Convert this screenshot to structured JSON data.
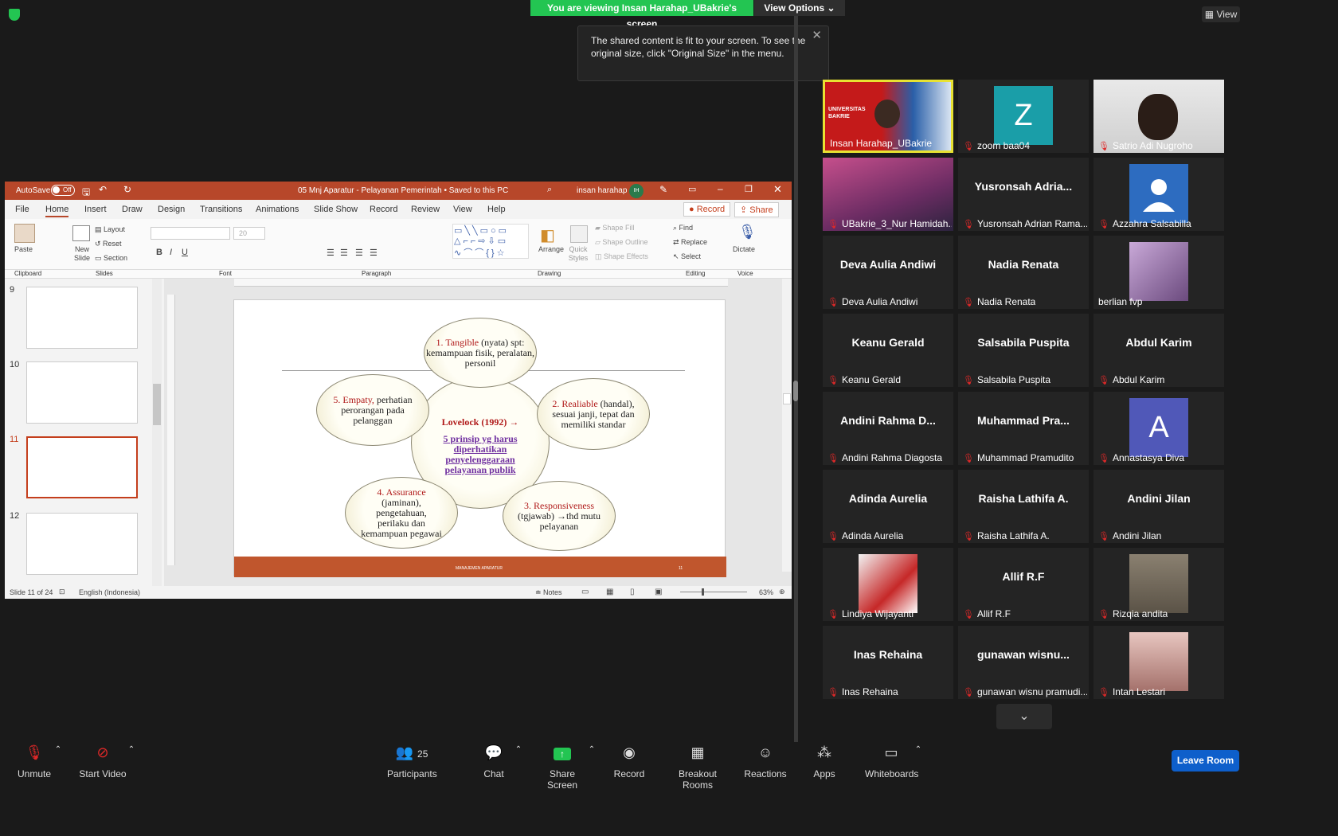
{
  "top": {
    "viewing_banner": "You are viewing Insan Harahap_UBakrie's screen",
    "view_options": "View Options",
    "view_button": "View",
    "tooltip": "The shared content is fit to your screen. To see the original size, click \"Original Size\" in the menu."
  },
  "ppt": {
    "autosave": "AutoSave",
    "autosave_state": "Off",
    "doc_title": "05 Mnj Aparatur - Pelayanan Pemerintah • Saved to this PC",
    "user": "insan harahap",
    "user_initials": "IH",
    "tabs": [
      "File",
      "Home",
      "Insert",
      "Draw",
      "Design",
      "Transitions",
      "Animations",
      "Slide Show",
      "Record",
      "Review",
      "View",
      "Help"
    ],
    "record_btn": "Record",
    "share_btn": "Share",
    "ribbon": {
      "paste": "Paste",
      "new_slide": "New Slide",
      "layout": "Layout",
      "reset": "Reset",
      "section": "Section",
      "font_size": "20",
      "arrange": "Arrange",
      "quick_styles": "Quick Styles",
      "shape_fill": "Shape Fill",
      "shape_outline": "Shape Outline",
      "shape_effects": "Shape Effects",
      "find": "Find",
      "replace": "Replace",
      "select": "Select",
      "dictate": "Dictate",
      "groups": [
        "Clipboard",
        "Slides",
        "Font",
        "Paragraph",
        "Drawing",
        "Editing",
        "Voice"
      ]
    },
    "thumb_numbers": [
      "9",
      "10",
      "11",
      "12"
    ],
    "slide": {
      "center_title": "Lovelock (1992) →",
      "center_body": "5 prinsip yg harus diperhatikan penyelenggaraan pelayanan publik",
      "p1_head": "1. Tangible",
      "p1_rest": "(nyata) spt: kemampuan fisik, peralatan, personil",
      "p2_head": "2. Realiable",
      "p2_rest": "(handal), sesuai janji, tepat dan memiliki standar",
      "p3_head": "3. Responsiveness",
      "p3_rest": "(tgjawab) →thd mutu pelayanan",
      "p4_head": "4. Assurance",
      "p4_rest": "(jaminan), pengetahuan, perilaku dan kemampuan pegawai",
      "p5_head": "5. Empaty,",
      "p5_rest": "perhatian perorangan pada pelanggan",
      "footer_left": "MANAJEMEN APARATUR",
      "footer_right": "11"
    },
    "status": {
      "slide_count": "Slide 11 of 24",
      "language": "English (Indonesia)",
      "notes": "Notes",
      "zoom": "63%"
    }
  },
  "participants": [
    {
      "name": "Insan Harahap_UBakrie",
      "big": "",
      "type": "video",
      "active": true,
      "muted": false
    },
    {
      "name": "zoom baa04",
      "big": "",
      "type": "letter",
      "letter": "Z",
      "color": "#1a9ea8",
      "muted": true
    },
    {
      "name": "Satrio Adi Nugroho",
      "big": "",
      "type": "video",
      "muted": true
    },
    {
      "name": "UBakrie_3_Nur Hamidah...",
      "big": "",
      "type": "video",
      "muted": true
    },
    {
      "name": "Yusronsah Adrian Rama...",
      "big": "Yusronsah  Adria...",
      "type": "text",
      "muted": true
    },
    {
      "name": "Azzahra Salsabilla",
      "big": "",
      "type": "person",
      "color": "#2d6cc0",
      "muted": true
    },
    {
      "name": "Deva Aulia Andiwi",
      "big": "Deva Aulia Andiwi",
      "type": "text",
      "muted": true
    },
    {
      "name": "Nadia Renata",
      "big": "Nadia Renata",
      "type": "text",
      "muted": true
    },
    {
      "name": "berlian fvp",
      "big": "",
      "type": "photo",
      "muted": false
    },
    {
      "name": "Keanu Gerald",
      "big": "Keanu Gerald",
      "type": "text",
      "muted": true
    },
    {
      "name": "Salsabila Puspita",
      "big": "Salsabila Puspita",
      "type": "text",
      "muted": true
    },
    {
      "name": "Abdul Karim",
      "big": "Abdul Karim",
      "type": "text",
      "muted": true
    },
    {
      "name": "Andini Rahma Diagosta",
      "big": "Andini  Rahma  D...",
      "type": "text",
      "muted": true
    },
    {
      "name": "Muhammad Pramudito",
      "big": "Muhammad  Pra...",
      "type": "text",
      "muted": true
    },
    {
      "name": "Annastasya Diva",
      "big": "",
      "type": "letter",
      "letter": "A",
      "color": "#5058b8",
      "muted": true
    },
    {
      "name": "Adinda Aurelia",
      "big": "Adinda Aurelia",
      "type": "text",
      "muted": true
    },
    {
      "name": "Raisha Lathifa A.",
      "big": "Raisha Lathifa A.",
      "type": "text",
      "muted": true
    },
    {
      "name": "Andini Jilan",
      "big": "Andini Jilan",
      "type": "text",
      "muted": true
    },
    {
      "name": "Lindiya Wijayanti",
      "big": "",
      "type": "photo",
      "muted": true
    },
    {
      "name": "Allif R.F",
      "big": "Allif R.F",
      "type": "text",
      "muted": true
    },
    {
      "name": "Rizqia andita",
      "big": "",
      "type": "photo",
      "muted": true
    },
    {
      "name": "Inas Rehaina",
      "big": "Inas Rehaina",
      "type": "text",
      "muted": true
    },
    {
      "name": "gunawan wisnu pramudi...",
      "big": "gunawan  wisnu...",
      "type": "text",
      "muted": true
    },
    {
      "name": "Intan Lestari",
      "big": "",
      "type": "photo",
      "muted": true
    }
  ],
  "toolbar": {
    "unmute": "Unmute",
    "start_video": "Start Video",
    "participants": "Participants",
    "participants_count": "25",
    "chat": "Chat",
    "share_screen": "Share Screen",
    "record": "Record",
    "breakout": "Breakout Rooms",
    "reactions": "Reactions",
    "apps": "Apps",
    "whiteboards": "Whiteboards",
    "leave": "Leave Room"
  },
  "colors": {
    "zoom_green": "#23c552",
    "ppt_red": "#b7472a",
    "leave_blue": "#0e5fcb",
    "muted_red": "#e02828",
    "active_border": "#e8e232"
  }
}
